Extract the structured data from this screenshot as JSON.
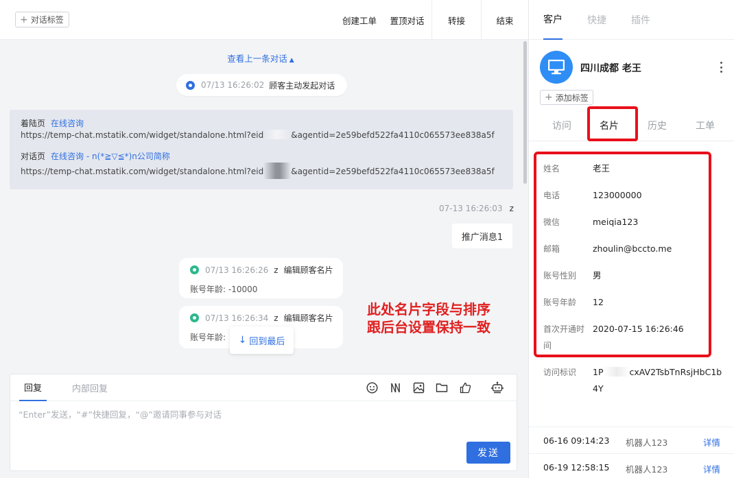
{
  "header": {
    "tag_button": "对话标签",
    "actions": [
      "创建工单",
      "置顶对话",
      "转接",
      "结束"
    ]
  },
  "chat": {
    "prev_link": "查看上一条对话",
    "start_event": {
      "time": "07/13 16:26:02",
      "text": "顾客主动发起对话"
    },
    "landing": {
      "label": "着陆页",
      "link": "在线咨询",
      "url_prefix": "https://temp-chat.mstatik.com/widget/standalone.html?eid",
      "url_suffix": "&agentid=2e59befd522fa4110c065573ee838a5f"
    },
    "dialog_page": {
      "label": "对话页",
      "link": "在线咨询 - n(*≧▽≦*)n公司简称",
      "url_prefix": "https://temp-chat.mstatik.com/widget/standalone.html?eid",
      "url_suffix": "&agentid=2e59befd522fa4110c065573ee838a5f"
    },
    "agent_message": {
      "time": "07-13 16:26:03",
      "sender": "z",
      "text": "推广消息1"
    },
    "events": [
      {
        "time": "07/13 16:26:26",
        "user": "z",
        "action": "编辑顾客名片",
        "detail": "账号年龄: -10000"
      },
      {
        "time": "07/13 16:26:34",
        "user": "z",
        "action": "编辑顾客名片",
        "detail": "账号年龄:"
      }
    ],
    "back_to_bottom": "回到最后",
    "annotation": [
      "此处名片字段与排序",
      "跟后台设置保持一致"
    ]
  },
  "reply": {
    "tabs": [
      {
        "label": "回复",
        "active": true
      },
      {
        "label": "内部回复",
        "active": false
      }
    ],
    "tools": [
      "smile-icon",
      "quick-phrase-icon",
      "image-icon",
      "folder-icon",
      "thumbs-up-icon",
      "robot-icon"
    ],
    "placeholder": "“Enter”发送，“#”快捷回复，“@”邀请同事参与对话",
    "send_label": "发送"
  },
  "right": {
    "tabs": [
      {
        "label": "客户",
        "active": true
      },
      {
        "label": "快捷",
        "active": false
      },
      {
        "label": "插件",
        "active": false
      }
    ],
    "customer_name": "四川成都 老王",
    "add_tag": "添加标签",
    "subtabs": [
      {
        "label": "访问",
        "active": false
      },
      {
        "label": "名片",
        "active": true
      },
      {
        "label": "历史",
        "active": false
      },
      {
        "label": "工单",
        "active": false
      }
    ],
    "fields": [
      {
        "label": "姓名",
        "value": "老王"
      },
      {
        "label": "电话",
        "value": "123000000"
      },
      {
        "label": "微信",
        "value": "meiqia123"
      },
      {
        "label": "邮箱",
        "value": "zhoulin@bccto.me"
      },
      {
        "label": "账号性别",
        "value": "男"
      },
      {
        "label": "账号年龄",
        "value": "12"
      },
      {
        "label": "首次开通时间",
        "value": "2020-07-15 16:26:46"
      }
    ],
    "visit_id": {
      "label": "访问标识",
      "value_start": "1P",
      "value_end": "cxAV2TsbTnRsjHbC1b4Y"
    },
    "history": [
      {
        "date": "06-16 09:14:23",
        "robot": "机器人123",
        "link": "详情"
      },
      {
        "date": "06-19 12:58:15",
        "robot": "机器人123",
        "link": "详情"
      }
    ]
  },
  "colors": {
    "accent": "#2f6fe0",
    "highlight": "#e8101a",
    "bot_event": "#2bb88a"
  }
}
